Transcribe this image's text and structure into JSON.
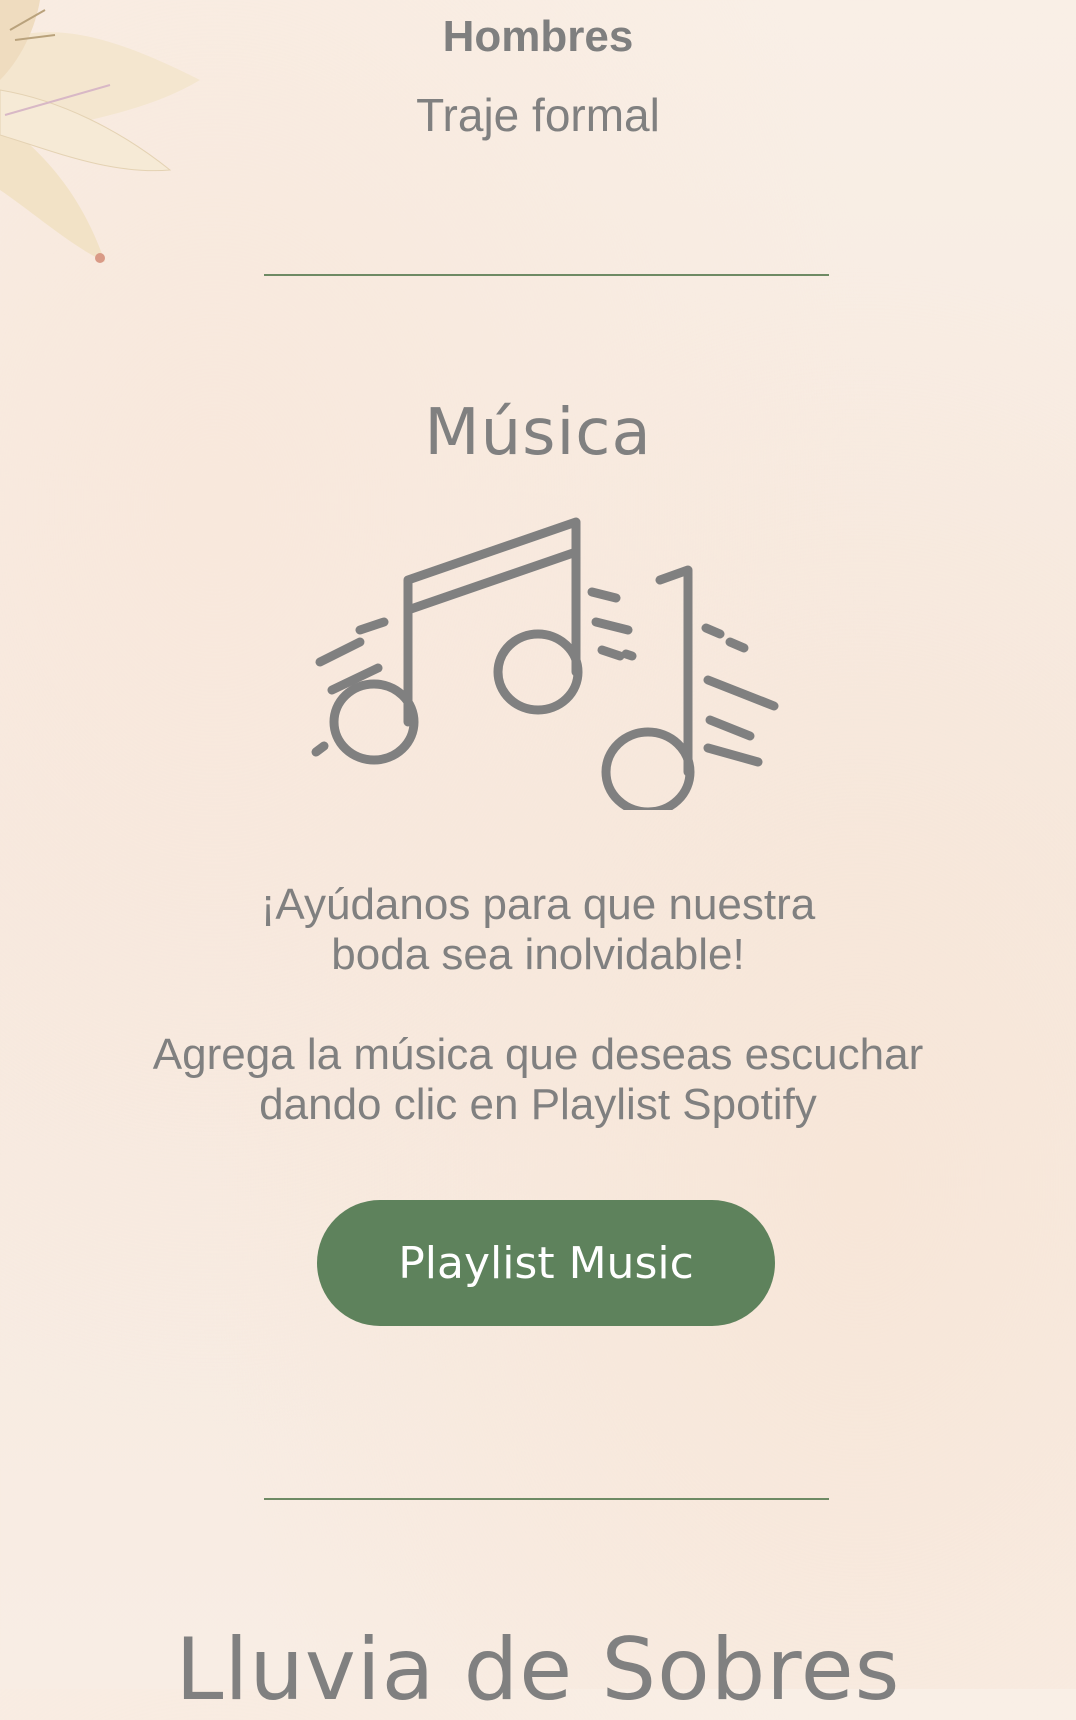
{
  "dress_code": {
    "title": "Hombres",
    "subtitle": "Traje formal"
  },
  "music_section": {
    "title": "Música",
    "icon": "music-notes-icon",
    "line1": "¡Ayúdanos para que nuestra",
    "line2": "boda sea inolvidable!",
    "line3": "Agrega la música que deseas escuchar",
    "line4": "dando clic en Playlist Spotify",
    "button_label": "Playlist Music"
  },
  "next_section": {
    "title": "Lluvia de Sobres"
  },
  "colors": {
    "accent": "#5e825c",
    "divider": "#6e8a64",
    "text": "#808080",
    "background": "#f8ede4"
  }
}
